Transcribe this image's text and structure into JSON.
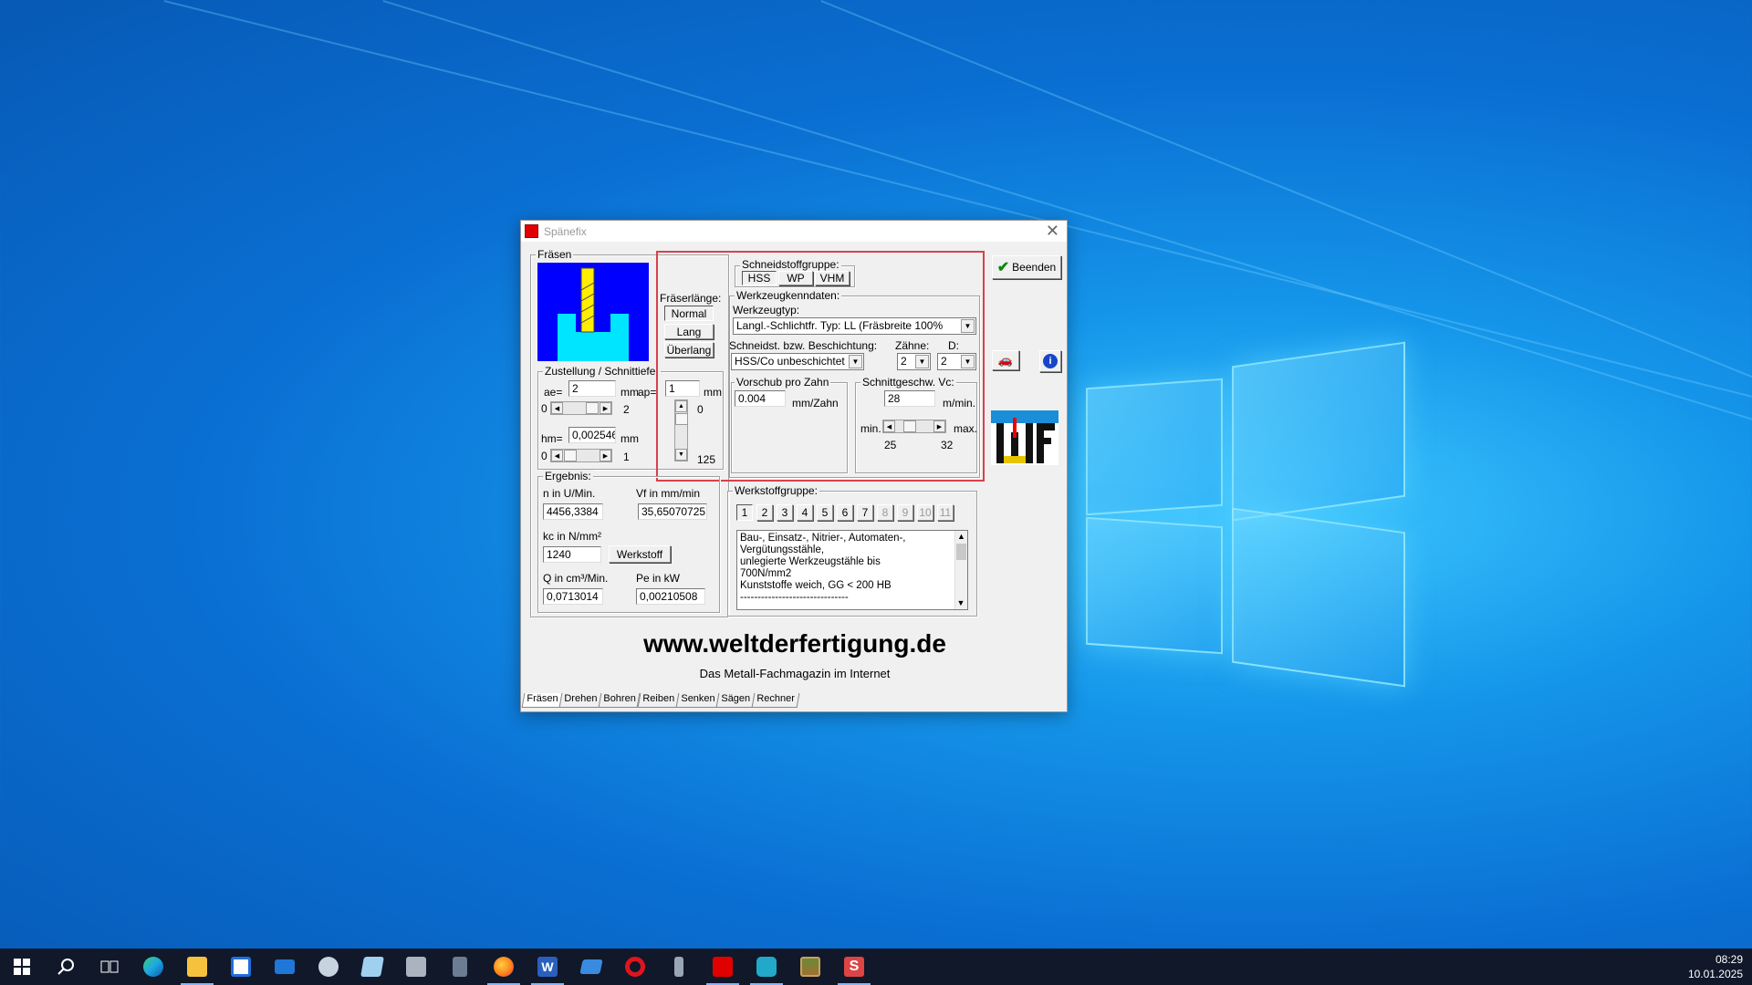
{
  "window": {
    "title": "Spänefix",
    "close_label": "✕",
    "beenden_label": "Beenden",
    "milling_group_label": "Fräsen",
    "schneidstoff": {
      "label": "Schneidstoffgruppe:",
      "options": [
        "HSS",
        "WP",
        "VHM"
      ],
      "selected": "HSS"
    },
    "fraeserlaenge": {
      "label": "Fräserlänge:",
      "options": [
        "Normal",
        "Lang",
        "Überlang"
      ],
      "selected": "Normal"
    },
    "werkzeug": {
      "group_label": "Werkzeugkenndaten:",
      "typ_label": "Werkzeugtyp:",
      "typ_value": "Langl.-Schlichtfr. Typ: LL (Fräsbreite 100%",
      "beschichtung_label": "Schneidst. bzw. Beschichtung:",
      "beschichtung_value": "HSS/Co unbeschichtet",
      "zaehne_label": "Zähne:",
      "zaehne_value": "2",
      "d_label": "D:",
      "d_value": "2"
    },
    "zustellung": {
      "group_label": "Zustellung / Schnittiefe:",
      "ae_label": "ae=",
      "ae_value": "2",
      "ae_unit": "mm",
      "ae_min": "0",
      "ae_max": "2",
      "ap_label": "ap=",
      "ap_value": "1",
      "ap_unit": "mm",
      "ap_min": "0",
      "ap_max": "125",
      "hm_label": "hm=",
      "hm_value": "0,002546",
      "hm_unit": "mm",
      "hm_min": "0",
      "hm_max": "1"
    },
    "vorschub": {
      "label": "Vorschub pro Zahn",
      "value": "0.004",
      "unit": "mm/Zahn"
    },
    "schnittgeschw": {
      "label": "Schnittgeschw. Vc:",
      "value": "28",
      "unit": "m/min.",
      "min_label": "min.",
      "max_label": "max.",
      "min_value": "25",
      "max_value": "32"
    },
    "ergebnis": {
      "group_label": "Ergebnis:",
      "n_label": "n in U/Min.",
      "n_value": "4456,3384",
      "vf_label": "Vf in mm/min",
      "vf_value": "35,65070725",
      "kc_label": "kc in N/mm²",
      "kc_value": "1240",
      "werkstoff_button": "Werkstoff",
      "q_label": "Q in cm³/Min.",
      "q_value": "0,0713014",
      "pe_label": "Pe in kW",
      "pe_value": "0,00210508"
    },
    "werkstoffgruppe": {
      "label": "Werkstoffgruppe:",
      "buttons": [
        "1",
        "2",
        "3",
        "4",
        "5",
        "6",
        "7",
        "8",
        "9",
        "10",
        "11"
      ],
      "enabled_count": 7,
      "selected": "1",
      "description": [
        "Bau-, Einsatz-, Nitrier-, Automaten-,",
        "Vergütungsstähle,",
        "unlegierte Werkzeugstähle bis",
        "700N/mm2",
        "Kunststoffe weich, GG < 200 HB",
        "-------------------------------"
      ]
    },
    "url": "www.weltderfertigung.de",
    "tagline": "Das Metall-Fachmagazin im Internet",
    "tabs": [
      "Fräsen",
      "Drehen",
      "Bohren",
      "Reiben",
      "Senken",
      "Sägen",
      "Rechner"
    ],
    "active_tab": "Fräsen",
    "logo_text": "WF"
  },
  "taskbar": {
    "time": "08:29",
    "date": "10.01.2025",
    "icons": [
      "start-icon",
      "search-icon",
      "task-view-icon",
      "edge-icon",
      "file-explorer-icon",
      "store-icon",
      "mail-icon",
      "paint-icon",
      "notepad-icon",
      "printer-icon",
      "calculator-icon",
      "firefox-icon",
      "word-icon",
      "folder-app-icon",
      "opera-icon",
      "usb-icon",
      "app-red-icon",
      "camera-icon",
      "picture-icon",
      "spaenefix-icon"
    ],
    "colors": {
      "edge": "#1ea7e1",
      "explorer": "#f6c23e",
      "firefox": "#ff7a1a",
      "word": "#2b5fbf",
      "opera": "#e0141e",
      "red": "#e00000",
      "sp": "#d44"
    }
  }
}
